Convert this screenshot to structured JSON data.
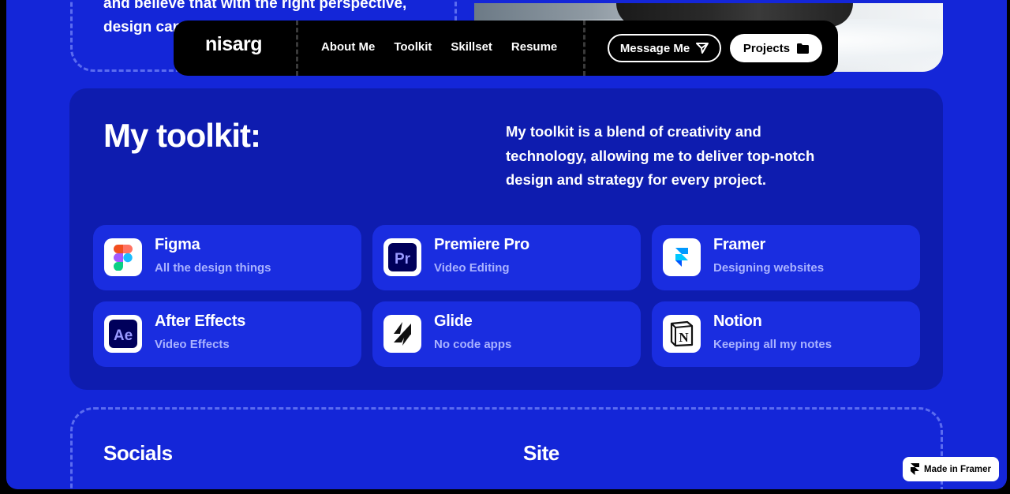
{
  "about": {
    "text_line1": "and believe that with the right perspective,",
    "text_line2": "design can"
  },
  "nav": {
    "brand": "nisarg",
    "links": [
      "About Me",
      "Toolkit",
      "Skillset",
      "Resume"
    ],
    "message_label": "Message Me",
    "projects_label": "Projects"
  },
  "toolkit": {
    "title": "My toolkit:",
    "description": "My toolkit is a blend of creativity and technology, allowing me to deliver top-notch design and strategy for every project.",
    "tools": [
      {
        "name": "Figma",
        "sub": "All the design things",
        "icon": "figma-icon"
      },
      {
        "name": "Premiere Pro",
        "sub": "Video Editing",
        "icon": "premiere-pro-icon"
      },
      {
        "name": "Framer",
        "sub": "Designing websites",
        "icon": "framer-icon"
      },
      {
        "name": "After Effects",
        "sub": "Video Effects",
        "icon": "after-effects-icon"
      },
      {
        "name": "Glide",
        "sub": "No code apps",
        "icon": "glide-icon"
      },
      {
        "name": "Notion",
        "sub": "Keeping all my notes",
        "icon": "notion-icon"
      }
    ]
  },
  "footer": {
    "socials": "Socials",
    "site": "Site"
  },
  "badge": {
    "label": "Made in Framer"
  },
  "colors": {
    "background": "#1426d8",
    "panel": "#0e1caf",
    "card": "#1a2de0",
    "nav": "#000000"
  }
}
